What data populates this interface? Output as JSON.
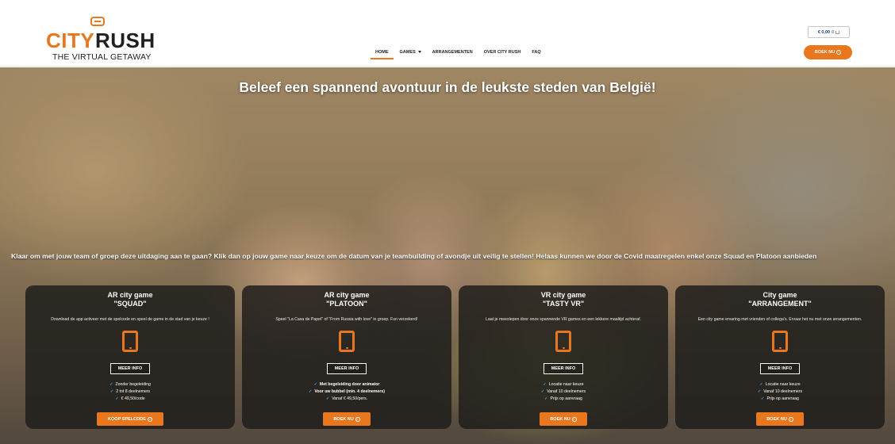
{
  "header": {
    "logo": {
      "top": "CITY",
      "bottom": "RUSH",
      "tagline": "THE VIRTUAL GETAWAY"
    },
    "nav": [
      {
        "label": "HOME",
        "active": true
      },
      {
        "label": "GAMES",
        "dropdown": true
      },
      {
        "label": "ARRANGEMENTEN"
      },
      {
        "label": "OVER CITY RUSH"
      },
      {
        "label": "FAQ"
      }
    ],
    "cart": {
      "amount": "€ 0,00",
      "count": "0"
    },
    "book_label": "BOEK NU"
  },
  "hero": {
    "title": "Beleef een spannend avontuur in de leukste steden van België!",
    "subtitle": "Klaar om met jouw team of groep deze uitdaging aan te gaan? Klik dan op jouw game naar keuze om de datum van je teambuilding of avondje uit veilig te stellen! Helaas kunnen we door de Covid maatregelen enkel onze Squad en Platoon aanbieden"
  },
  "cards": [
    {
      "title_line1": "AR city game",
      "title_line2": "\"SQUAD\"",
      "description": "Download de app activeer met de spelcode en speel de game in de stad van je keuze !",
      "info_label": "MEER INFO",
      "features": [
        "Zonder begeleiding",
        "2 tot 8 deelnemers",
        "€ 49,50/code"
      ],
      "button_label": "KOOP SPELCODE"
    },
    {
      "title_line1": "AR city game",
      "title_line2": "\"PLATOON\"",
      "description": "Speel \"La Casa de Papel\" of \"From Russia with love\" in groep. Fun verzekerd!",
      "info_label": "MEER INFO",
      "features": [
        "Met begeleiding door animator",
        "Voor uw bubbel (min. 4 deelnemers)",
        "Vanaf € 49,50/pers."
      ],
      "button_label": "BOEK NU"
    },
    {
      "title_line1": "VR city game",
      "title_line2": "\"TASTY VR\"",
      "description": "Laat je meeslepen door onze spannende VR games en een lekkere maaltijd achteraf.",
      "info_label": "MEER INFO",
      "features": [
        "Locatie naar keuze",
        "Vanaf 10 deelnemers",
        "Prijs op aanvraag"
      ],
      "button_label": "BOEK NU"
    },
    {
      "title_line1": "City game",
      "title_line2": "\"ARRANGEMENT\"",
      "description": "Een city game ervaring met vrienden of collega's. Ervaar het nu met onze arrangementen.",
      "info_label": "MEER INFO",
      "features": [
        "Locatie naar keuze",
        "Vanaf 10 deelnemers",
        "Prijs op aanvraag"
      ],
      "button_label": "BOEK NU"
    }
  ],
  "colors": {
    "accent": "#e8771e",
    "check": "#3fa8ff"
  }
}
